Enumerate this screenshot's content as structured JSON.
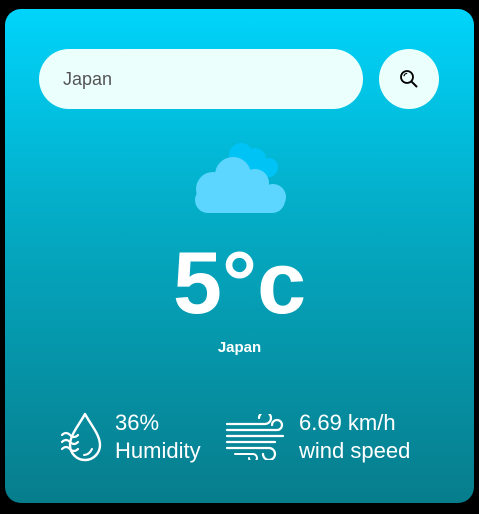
{
  "search": {
    "value": "Japan",
    "button_icon": "search-icon"
  },
  "weather": {
    "icon": "cloud-icon",
    "temperature": "5°c",
    "city": "Japan"
  },
  "humidity": {
    "icon": "humidity-icon",
    "value": "36%",
    "label": "Humidity"
  },
  "wind": {
    "icon": "wind-icon",
    "value": "6.69 km/h",
    "label": "wind speed"
  },
  "colors": {
    "gradient_top": "#00d4fb",
    "gradient_bottom": "#077d8c",
    "input_bg": "#ebfffc",
    "cloud_front": "#5dd6ff",
    "cloud_back": "#00c3f5"
  }
}
